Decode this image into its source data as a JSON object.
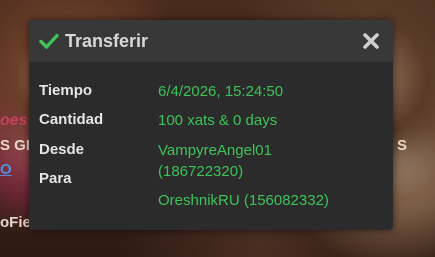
{
  "background": {
    "fragment_1": "oes",
    "fragment_2": "S GI",
    "fragment_3": "O",
    "fragment_4": "oFie",
    "fragment_5": "S"
  },
  "dialog": {
    "title": "Transferir",
    "check_icon": "check-icon",
    "close_icon": "close-icon",
    "accent_color": "#3ec35a",
    "fields": {
      "time_label": "Tiempo",
      "time_value": "6/4/2026, 15:24:50",
      "amount_label": "Cantidad",
      "amount_value": "100 xats & 0 days",
      "from_label": "Desde",
      "from_value_line1": "VampyreAngel01",
      "from_value_line2": "(186722320)",
      "to_label": "Para",
      "to_value": "OreshnikRU (156082332)"
    }
  }
}
